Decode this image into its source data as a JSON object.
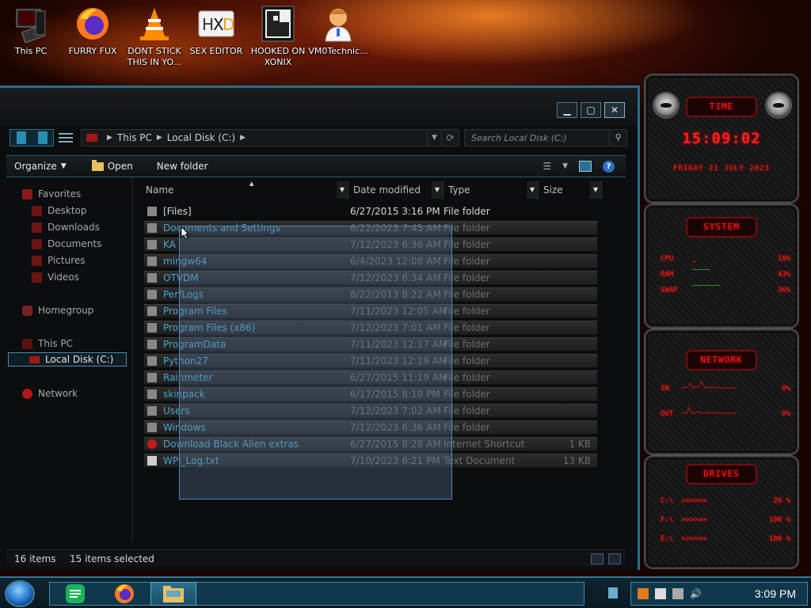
{
  "desktop_icons": [
    {
      "label": "This PC"
    },
    {
      "label": "FURRY FUX"
    },
    {
      "label": "DONT STICK THIS IN YO..."
    },
    {
      "label": "SEX EDITOR"
    },
    {
      "label": "HOOKED ON XONIX"
    },
    {
      "label": "VM0Technic..."
    }
  ],
  "explorer": {
    "breadcrumb": [
      "This PC",
      "Local Disk (C:)"
    ],
    "search_placeholder": "Search Local Disk (C:)",
    "toolbar": {
      "organize": "Organize",
      "open": "Open",
      "new_folder": "New folder"
    },
    "nav": {
      "favorites": "Favorites",
      "favorites_items": [
        "Desktop",
        "Downloads",
        "Documents",
        "Pictures",
        "Videos"
      ],
      "homegroup": "Homegroup",
      "this_pc": "This PC",
      "local_disk": "Local Disk (C:)",
      "network": "Network"
    },
    "columns": {
      "name": "Name",
      "date": "Date modified",
      "type": "Type",
      "size": "Size"
    },
    "files": [
      {
        "name": "[Files]",
        "date": "6/27/2015 3:16 PM",
        "type": "File folder",
        "size": "",
        "selected": false
      },
      {
        "name": "Documents and Settings",
        "date": "6/22/2023 7:45 AM",
        "type": "File folder",
        "size": "",
        "selected": true
      },
      {
        "name": "KA",
        "date": "7/12/2023 6:36 AM",
        "type": "File folder",
        "size": "",
        "selected": true
      },
      {
        "name": "mingw64",
        "date": "6/4/2023 12:08 AM",
        "type": "File folder",
        "size": "",
        "selected": true
      },
      {
        "name": "OTVDM",
        "date": "7/12/2023 6:34 AM",
        "type": "File folder",
        "size": "",
        "selected": true
      },
      {
        "name": "PerfLogs",
        "date": "8/22/2013 8:22 AM",
        "type": "File folder",
        "size": "",
        "selected": true
      },
      {
        "name": "Program Files",
        "date": "7/11/2023 12:05 AM",
        "type": "File folder",
        "size": "",
        "selected": true
      },
      {
        "name": "Program Files (x86)",
        "date": "7/12/2023 7:01 AM",
        "type": "File folder",
        "size": "",
        "selected": true
      },
      {
        "name": "ProgramData",
        "date": "7/11/2023 12:17 AM",
        "type": "File folder",
        "size": "",
        "selected": true
      },
      {
        "name": "Python27",
        "date": "7/11/2023 12:19 AM",
        "type": "File folder",
        "size": "",
        "selected": true
      },
      {
        "name": "Rainmeter",
        "date": "6/27/2015 11:19 AM",
        "type": "File folder",
        "size": "",
        "selected": true
      },
      {
        "name": "skinpack",
        "date": "6/17/2015 8:19 PM",
        "type": "File folder",
        "size": "",
        "selected": true
      },
      {
        "name": "Users",
        "date": "7/12/2023 7:02 AM",
        "type": "File folder",
        "size": "",
        "selected": true
      },
      {
        "name": "Windows",
        "date": "7/12/2023 6:36 AM",
        "type": "File folder",
        "size": "",
        "selected": true
      },
      {
        "name": "Download Black Alien extras",
        "date": "6/27/2015 8:28 AM",
        "type": "Internet Shortcut",
        "size": "1 KB",
        "selected": true
      },
      {
        "name": "WPI_Log.txt",
        "date": "7/10/2023 6:21 PM",
        "type": "Text Document",
        "size": "13 KB",
        "selected": true
      }
    ],
    "status": {
      "items": "16 items",
      "selected": "15 items selected"
    }
  },
  "rainmeter": {
    "time_title": "TIME",
    "time": "15:09:02",
    "date": "FRIDAY 21 JULY 2023",
    "system_title": "SYSTEM",
    "system": [
      {
        "label": "CPU",
        "value": "18%"
      },
      {
        "label": "RAM",
        "value": "43%"
      },
      {
        "label": "SWAP",
        "value": "36%"
      }
    ],
    "network_title": "NETWORK",
    "network": [
      {
        "label": "IN",
        "value": "0%"
      },
      {
        "label": "OUT",
        "value": "0%"
      }
    ],
    "drives_title": "DRIVES",
    "drives": [
      {
        "label": "C:\\",
        "bar": ">>>>>>",
        "value": "26 %"
      },
      {
        "label": "F:\\",
        "bar": ">>>>>>",
        "value": "100 %"
      },
      {
        "label": "E:\\",
        "bar": ">>>>>>",
        "value": "100 %"
      }
    ]
  },
  "taskbar": {
    "clock": "3:09 PM"
  },
  "colors": {
    "accent": "#2e7a98",
    "selection_text": "#4aa3d4",
    "gadget_red": "#ff2020"
  }
}
